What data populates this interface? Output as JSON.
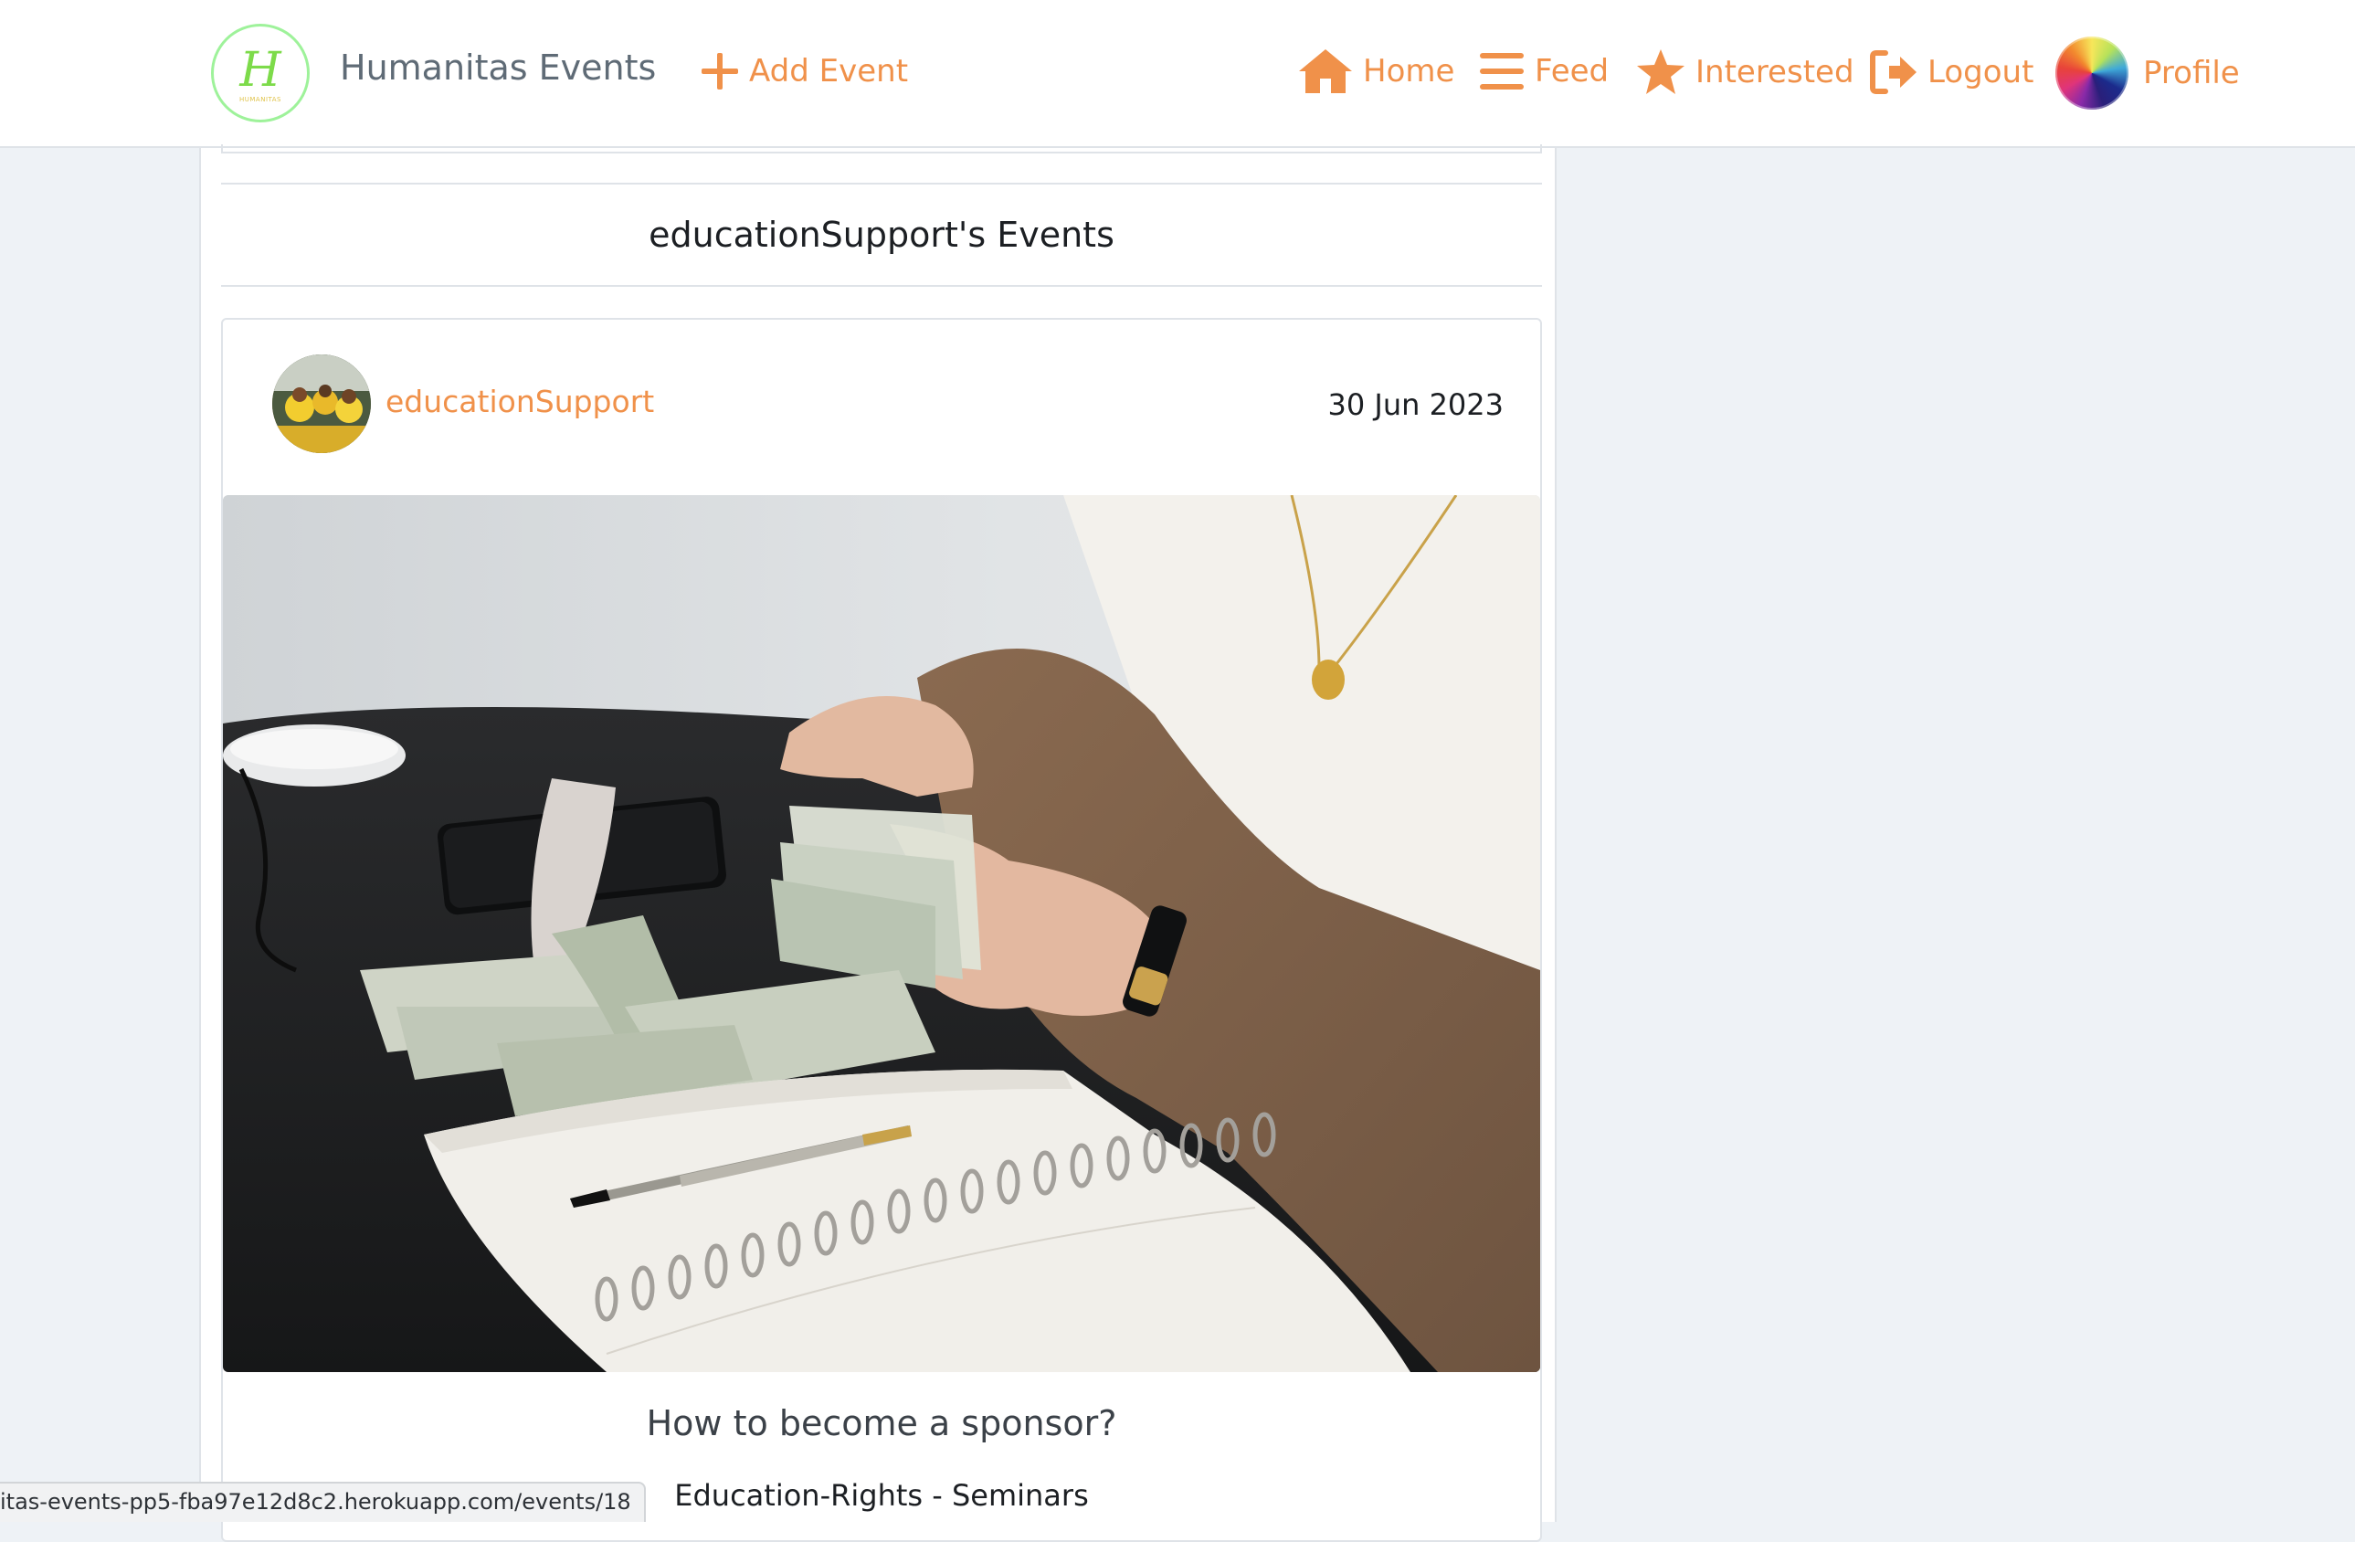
{
  "app": {
    "brand": "Humanitas Events",
    "logo_letter": "H",
    "logo_subtext": "HUMANITAS"
  },
  "nav": {
    "add_event": "Add Event",
    "home": "Home",
    "feed": "Feed",
    "interested": "Interested",
    "logout": "Logout",
    "profile": "Profile"
  },
  "section": {
    "title": "educationSupport's Events"
  },
  "event": {
    "owner": "educationSupport",
    "date": "30 Jun 2023",
    "title": "How to become a sponsor?",
    "category": "Education-Rights - Seminars"
  },
  "status_bar": {
    "url": "itas-events-pp5-fba97e12d8c2.herokuapp.com/events/18"
  },
  "colors": {
    "accent": "#f0914a",
    "background": "#eef2f6",
    "border": "#dfe3e8",
    "logo_ring": "#9ef29a"
  }
}
